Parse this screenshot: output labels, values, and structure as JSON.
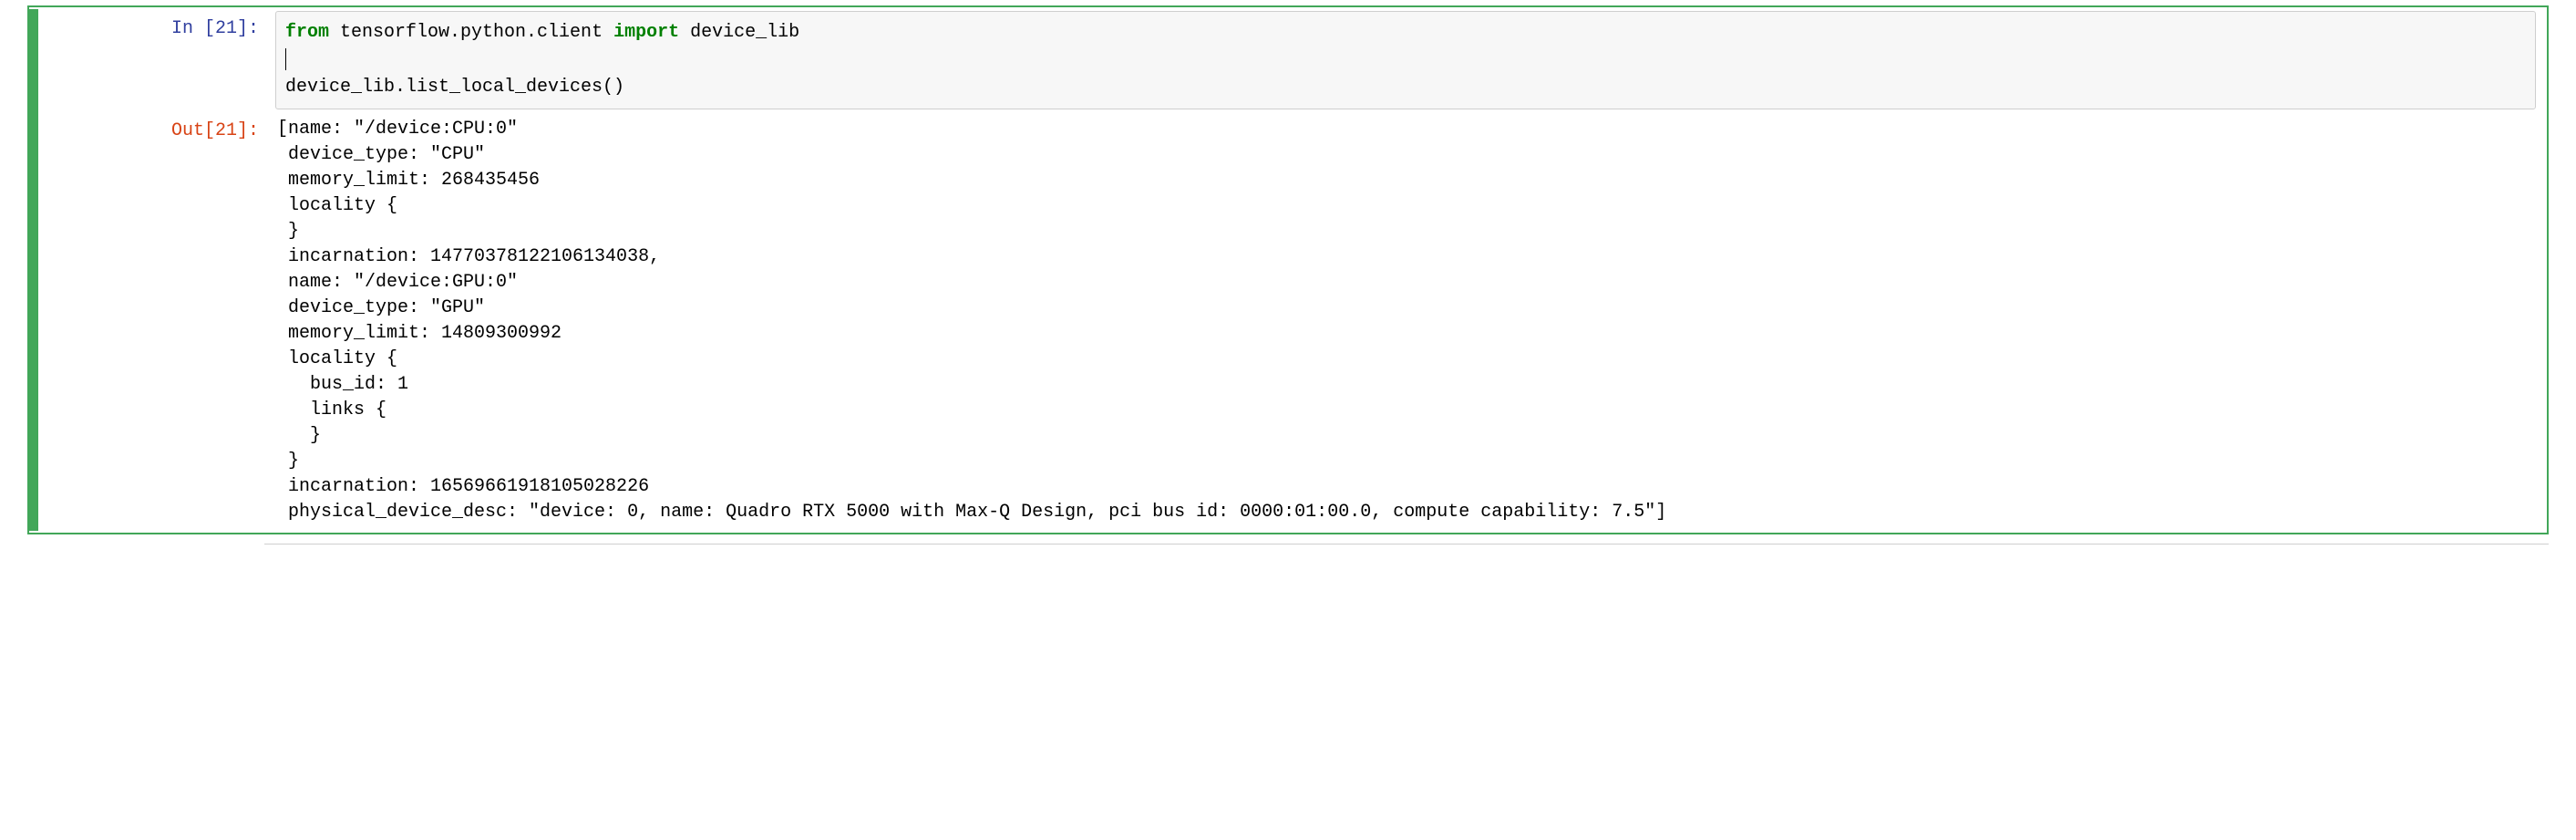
{
  "input_prompt": {
    "prefix": "In  [",
    "number": "21",
    "suffix": "]:"
  },
  "output_prompt": {
    "prefix": "Out[",
    "number": "21",
    "suffix": "]:"
  },
  "code": {
    "kw_from": "from",
    "module": " tensorflow.python.client ",
    "kw_import": "import",
    "imported": " device_lib",
    "line2": "",
    "line3": "device_lib.list_local_devices()"
  },
  "output_lines": [
    "[name: \"/device:CPU:0\"",
    " device_type: \"CPU\"",
    " memory_limit: 268435456",
    " locality {",
    " }",
    " incarnation: 14770378122106134038,",
    " name: \"/device:GPU:0\"",
    " device_type: \"GPU\"",
    " memory_limit: 14809300992",
    " locality {",
    "   bus_id: 1",
    "   links {",
    "   }",
    " }",
    " incarnation: 16569661918105028226",
    " physical_device_desc: \"device: 0, name: Quadro RTX 5000 with Max-Q Design, pci bus id: 0000:01:00.0, compute capability: 7.5\"]"
  ]
}
